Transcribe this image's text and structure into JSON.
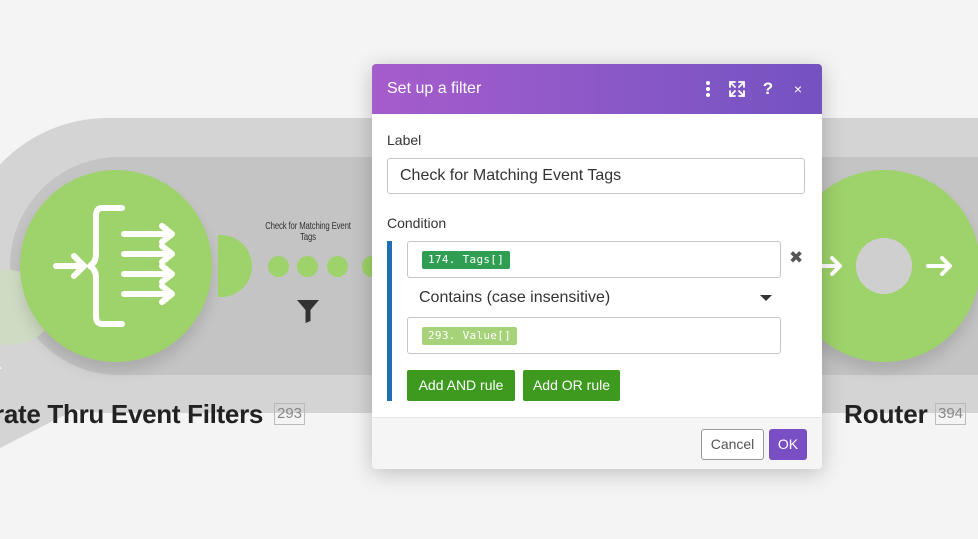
{
  "scenario": {
    "left_module": {
      "name": "rate Thru Event Filters",
      "id": "293"
    },
    "route_label": "Check for Matching Event Tags",
    "right_module": {
      "name": "Router",
      "id": "394"
    },
    "icons": [
      "iterator-icon",
      "filter-icon",
      "arrow-right-icon"
    ],
    "colors": {
      "module_green": "#9ed26a",
      "band_gray": "#d4d4d4"
    }
  },
  "modal": {
    "title": "Set up a filter",
    "header_buttons": [
      "kebab-menu-icon",
      "expand-icon",
      "help-icon",
      "close-icon"
    ],
    "help_glyph": "?",
    "close_glyph": "×",
    "label_caption": "Label",
    "label_value": "Check for Matching Event Tags",
    "condition_caption": "Condition",
    "condition": {
      "operand_a": {
        "text": "174. Tags[]",
        "color": "#2f9e52"
      },
      "operator": "Contains (case insensitive)",
      "operand_b": {
        "text": "293. Value[]",
        "color": "#a6d27a"
      },
      "remove_glyph": "✖"
    },
    "add_and_label": "Add AND rule",
    "add_or_label": "Add OR rule",
    "cancel_label": "Cancel",
    "ok_label": "OK",
    "colors": {
      "header_gradient_start": "#a65ccb",
      "header_gradient_end": "#7452c0",
      "condition_bar": "#1f6fb2",
      "rule_button": "#3d9a1f",
      "ok_button": "#7a4fc3"
    }
  }
}
